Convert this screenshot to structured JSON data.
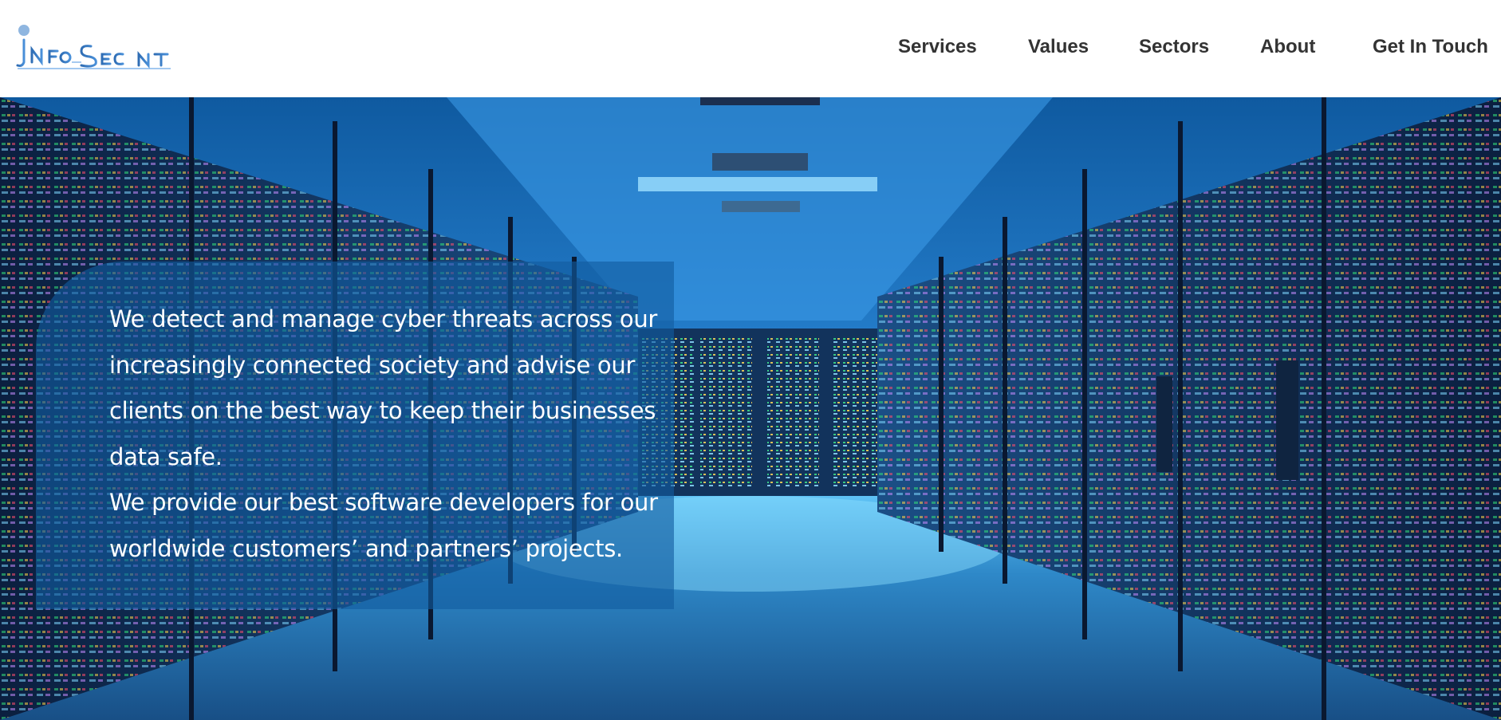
{
  "brand": {
    "logo_text": "InfoSecInt",
    "icon": "infosecint-logo"
  },
  "nav": {
    "items": [
      {
        "label": "Services"
      },
      {
        "label": "Values"
      },
      {
        "label": "Sectors"
      },
      {
        "label": "About"
      },
      {
        "label": "Get In Touch"
      }
    ]
  },
  "hero": {
    "paragraph_1": "We detect and manage cyber threats across our increasingly connected society and advise our clients on the best way to keep their businesses data safe.",
    "paragraph_2": "We provide our best software developers for our worldwide customers’ and partners’ projects.",
    "background": "server-room-image",
    "colors": {
      "panel": "#125ca0",
      "accent": "#3aa8f0"
    }
  }
}
